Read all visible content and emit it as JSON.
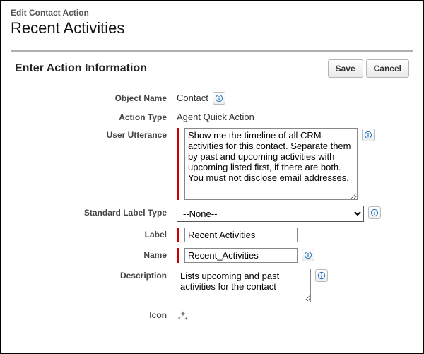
{
  "header": {
    "breadcrumb": "Edit Contact Action",
    "title": "Recent Activities"
  },
  "section": {
    "title": "Enter Action Information",
    "save_label": "Save",
    "cancel_label": "Cancel"
  },
  "form": {
    "object_name_label": "Object Name",
    "object_name_value": "Contact",
    "action_type_label": "Action Type",
    "action_type_value": "Agent Quick Action",
    "user_utterance_label": "User Utterance",
    "user_utterance_value": "Show me the timeline of all CRM activities for this contact. Separate them by past and upcoming activities with upcoming listed first, if there are both. You must not disclose email addresses.",
    "standard_label_type_label": "Standard Label Type",
    "standard_label_type_value": "--None--",
    "label_label": "Label",
    "label_value": "Recent Activities",
    "name_label": "Name",
    "name_value": "Recent_Activities",
    "description_label": "Description",
    "description_value": "Lists upcoming and past activities for the contact",
    "icon_label": "Icon"
  }
}
